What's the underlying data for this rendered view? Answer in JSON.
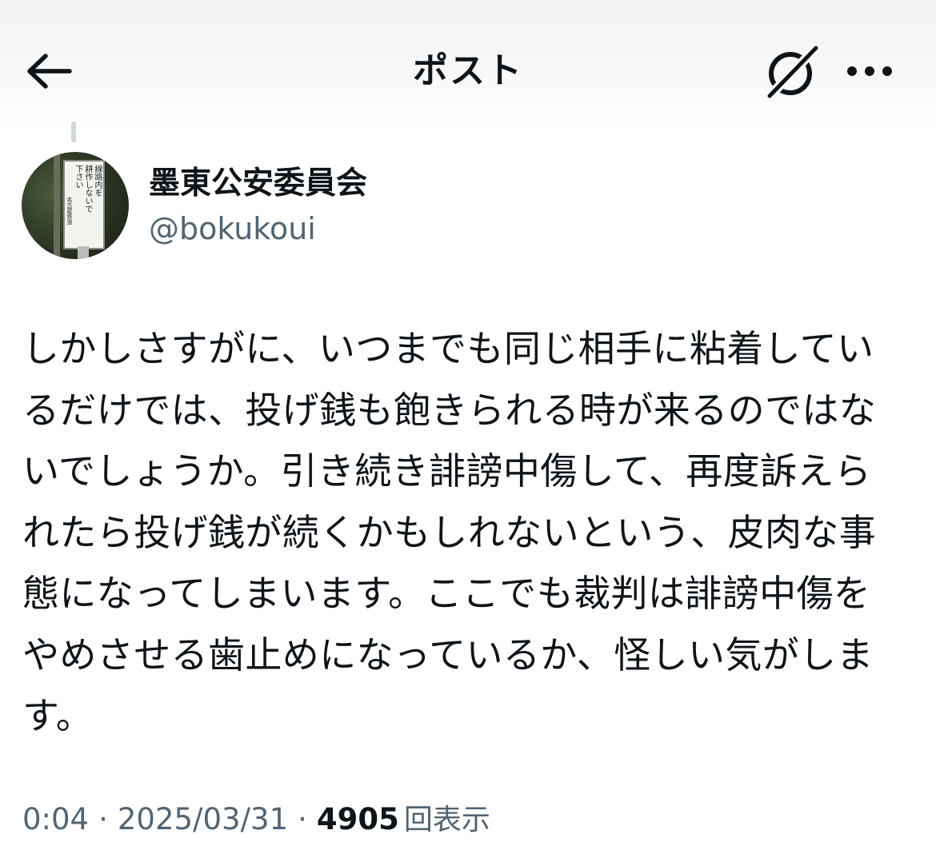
{
  "header": {
    "title": "ポスト",
    "back_icon": "arrow-left-icon",
    "grok_icon": "grok-icon",
    "more_icon": "more-horizontal-icon"
  },
  "author": {
    "display_name": "墨東公安委員会",
    "handle": "@bokukoui",
    "avatar_sign_lines": [
      "線路内を",
      "耕作しないで",
      "下さい",
      "名古屋鉄道"
    ]
  },
  "post": {
    "text": "しかしさすがに、いつまでも同じ相手に粘着しているだけでは、投げ銭も飽きられる時が来るのではないでしょうか。引き続き誹謗中傷して、再度訴えられたら投げ銭が続くかもしれないという、皮肉な事態になってしまいます。ここでも裁判は誹謗中傷をやめさせる歯止めになっているか、怪しい気がします。"
  },
  "meta": {
    "time": "0:04",
    "date": "2025/03/31",
    "separator": "·",
    "views_count": "4905",
    "views_label": "回表示"
  },
  "colors": {
    "text_primary": "#0f1419",
    "text_secondary": "#536471",
    "thread_line": "#cfd9de"
  }
}
